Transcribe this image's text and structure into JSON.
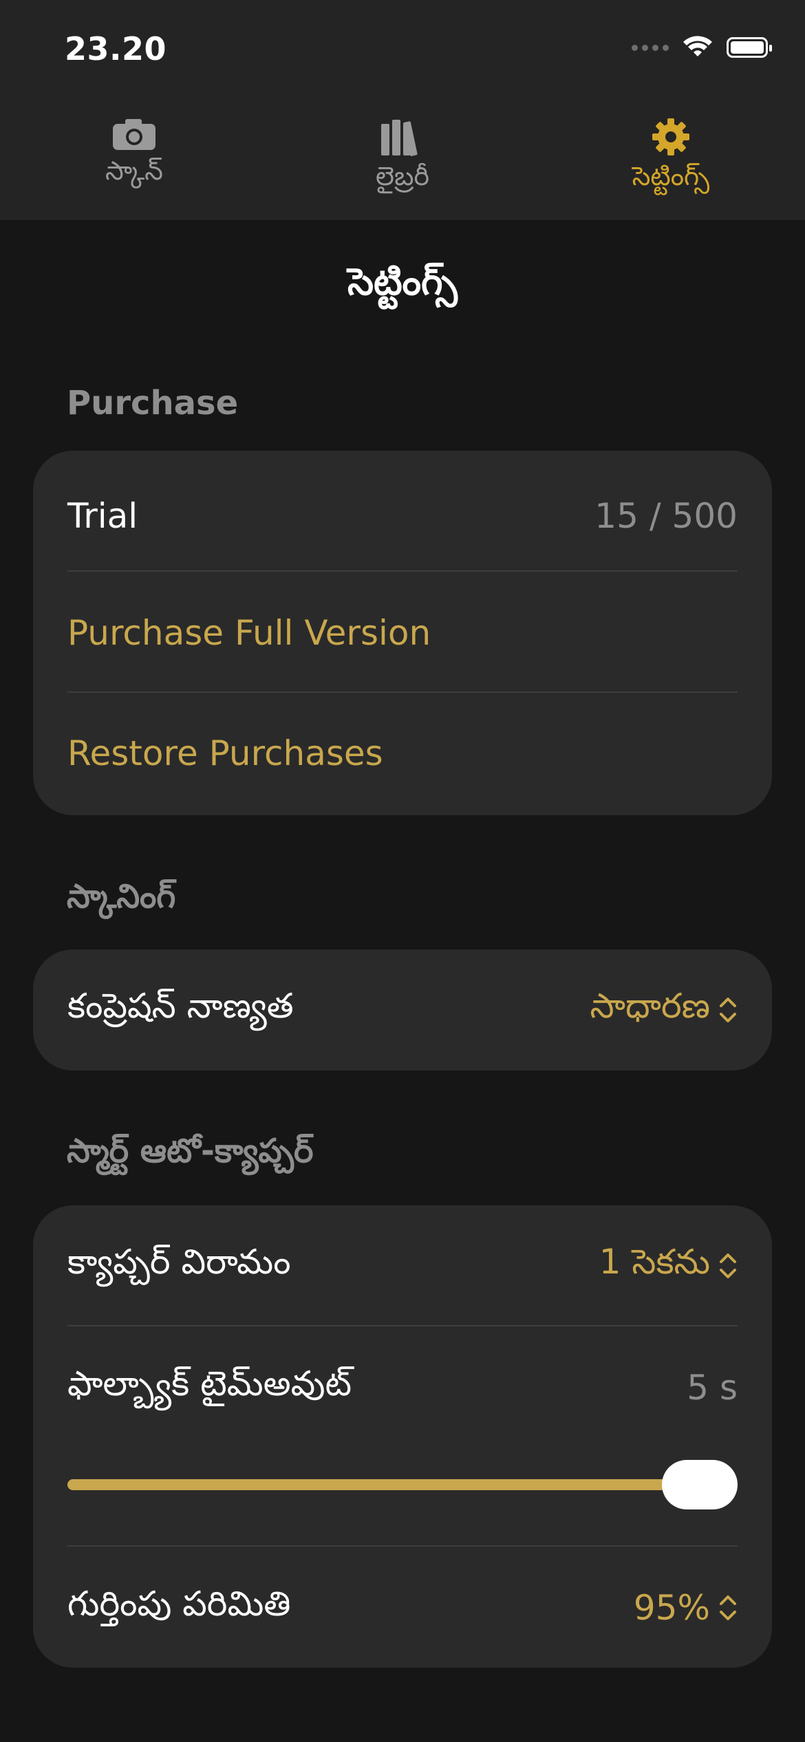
{
  "status_bar": {
    "time": "23.20",
    "icons": [
      "signal-dots-icon",
      "wifi-icon",
      "battery-icon"
    ]
  },
  "tabs": [
    {
      "label": "స్కాన్",
      "icon": "camera-icon",
      "active": false
    },
    {
      "label": "లైబ్రరీ",
      "icon": "library-icon",
      "active": false
    },
    {
      "label": "సెట్టింగ్స్",
      "icon": "gear-icon",
      "active": true
    }
  ],
  "page_title": "సెట్టింగ్స్",
  "purchase": {
    "header": "Purchase",
    "trial_label": "Trial",
    "trial_value": "15 / 500",
    "purchase_full": "Purchase Full Version",
    "restore": "Restore Purchases"
  },
  "scanning": {
    "header": "స్కానింగ్",
    "compression_label": "కంప్రెషన్ నాణ్యత",
    "compression_value": "సాధారణ"
  },
  "auto_capture": {
    "header": "స్మార్ట్ ఆటో-క్యాప్చర్",
    "interval_label": "క్యాప్చర్ విరామం",
    "interval_value": "1 సెకను",
    "fallback_label": "ఫాల్బ్యాక్ టైమ్‌అవుట్",
    "fallback_value": "5 s",
    "fallback_slider_fraction": 1.0,
    "threshold_label": "గుర్తింపు పరిమితి",
    "threshold_value": "95%"
  },
  "colors": {
    "accent": "#d4a62a",
    "link": "#c9a74d",
    "background": "#161616",
    "card": "#2a2a2a",
    "tabbar": "#242424"
  }
}
